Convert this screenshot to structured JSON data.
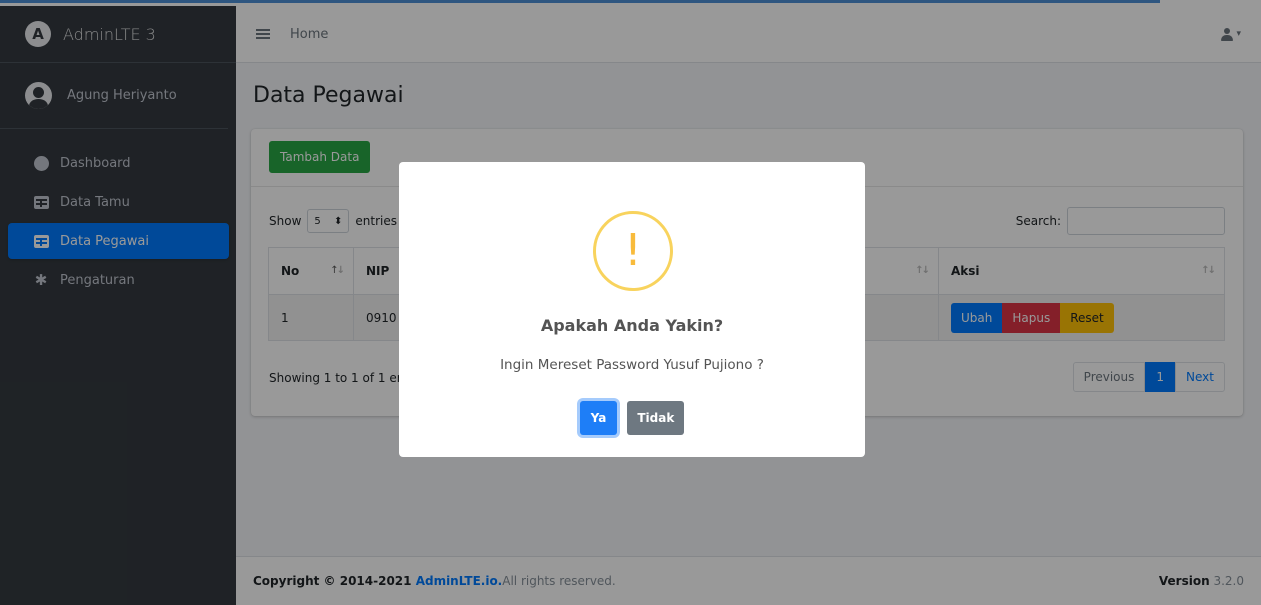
{
  "brand": {
    "logo_letter": "A",
    "name": "AdminLTE 3"
  },
  "user": {
    "name": "Agung Heriyanto"
  },
  "sidebar": {
    "items": [
      {
        "label": "Dashboard",
        "icon": "dashboard-icon",
        "active": false
      },
      {
        "label": "Data Tamu",
        "icon": "table-icon",
        "active": false
      },
      {
        "label": "Data Pegawai",
        "icon": "table-icon",
        "active": true
      },
      {
        "label": "Pengaturan",
        "icon": "gear-icon",
        "active": false
      }
    ]
  },
  "navbar": {
    "home_label": "Home",
    "menu_icon": "hamburger-icon",
    "user_icon": "user-icon"
  },
  "page": {
    "title": "Data Pegawai"
  },
  "card": {
    "add_button": "Tambah Data",
    "show_label": "Show",
    "page_size": "5",
    "entries_label": "entries",
    "search_label": "Search:",
    "search_value": "",
    "columns": [
      "No",
      "NIP",
      "",
      "Aksi"
    ],
    "rows": [
      {
        "no": "1",
        "nip": "0910"
      }
    ],
    "row_actions": {
      "edit": "Ubah",
      "delete": "Hapus",
      "reset": "Reset"
    },
    "info": "Showing 1 to 1 of 1 er",
    "pagination": {
      "previous": "Previous",
      "current": "1",
      "next": "Next"
    }
  },
  "footer": {
    "copyright_prefix": "Copyright © 2014-2021 ",
    "link_text": "AdminLTE.io.",
    "suffix": " All rights reserved.",
    "version_label": "Version",
    "version_number": " 3.2.0"
  },
  "dialog": {
    "icon": "warning-icon",
    "icon_glyph": "!",
    "title": "Apakah Anda Yakin?",
    "text": "Ingin Mereset Password Yusuf Pujiono ?",
    "confirm_label": "Ya",
    "cancel_label": "Tidak"
  },
  "colors": {
    "accent": "#007bff",
    "success": "#28a745",
    "danger": "#dc3545",
    "warning": "#ffc107",
    "sidebar": "#343a40"
  }
}
